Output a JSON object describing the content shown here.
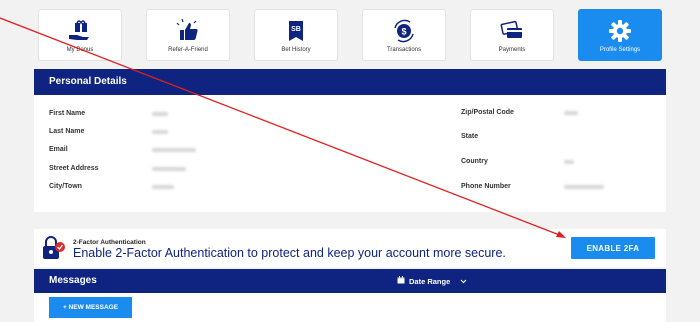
{
  "tabs": [
    {
      "label": "My Bonus",
      "icon": "gift-hand-icon"
    },
    {
      "label": "Refer-A-Friend",
      "icon": "thumbs-up-icon"
    },
    {
      "label": "Bet History",
      "icon": "bet-slip-icon"
    },
    {
      "label": "Transactions",
      "icon": "dollar-cycle-icon"
    },
    {
      "label": "Payments",
      "icon": "credit-cards-icon"
    },
    {
      "label": "Profile Settings",
      "icon": "gear-icon"
    }
  ],
  "personal": {
    "title": "Personal Details",
    "left_labels": [
      "First Name",
      "Last Name",
      "Email",
      "Street Address",
      "City/Town"
    ],
    "right_labels": [
      "Zip/Postal Code",
      "State",
      "Country",
      "Phone Number"
    ]
  },
  "tfa": {
    "small": "2-Factor Authentication",
    "big": "Enable 2-Factor Authentication to protect and keep your account more secure.",
    "button": "ENABLE 2FA"
  },
  "messages": {
    "title": "Messages",
    "date_range": "Date Range",
    "new_button": "+ NEW MESSAGE"
  },
  "colors": {
    "navy": "#0f2480",
    "blue": "#1a8cf0",
    "arrow": "#e02020"
  }
}
